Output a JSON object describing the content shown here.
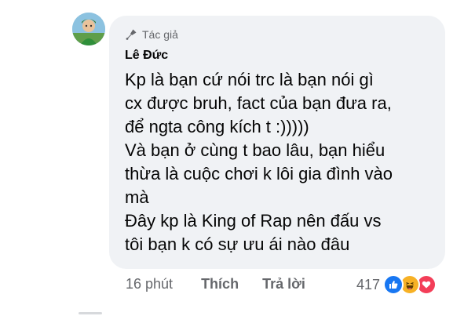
{
  "comment": {
    "author_badge": "Tác giả",
    "author_name": "Lê Đức",
    "lines": [
      "Kp là bạn cứ nói trc là bạn nói gì",
      "cx được bruh, fact của bạn đưa ra,",
      "để ngta công kích t :)))))",
      "Và bạn ở cùng t bao lâu, bạn hiểu",
      "thừa là cuộc chơi k lôi gia đình vào",
      "mà",
      "Đây kp là King of Rap nên đấu vs",
      "tôi bạn k có sự ưu ái nào đâu"
    ]
  },
  "actions": {
    "time": "16 phút",
    "like_label": "Thích",
    "reply_label": "Trả lời",
    "reaction_count": "417",
    "reactions": [
      "like-icon",
      "haha-icon",
      "love-icon"
    ]
  },
  "colors": {
    "bubble": "#f0f2f5",
    "text": "#050505",
    "meta": "#65676b",
    "like": "#1877f2",
    "haha": "#f7b125",
    "love": "#f33e58"
  }
}
